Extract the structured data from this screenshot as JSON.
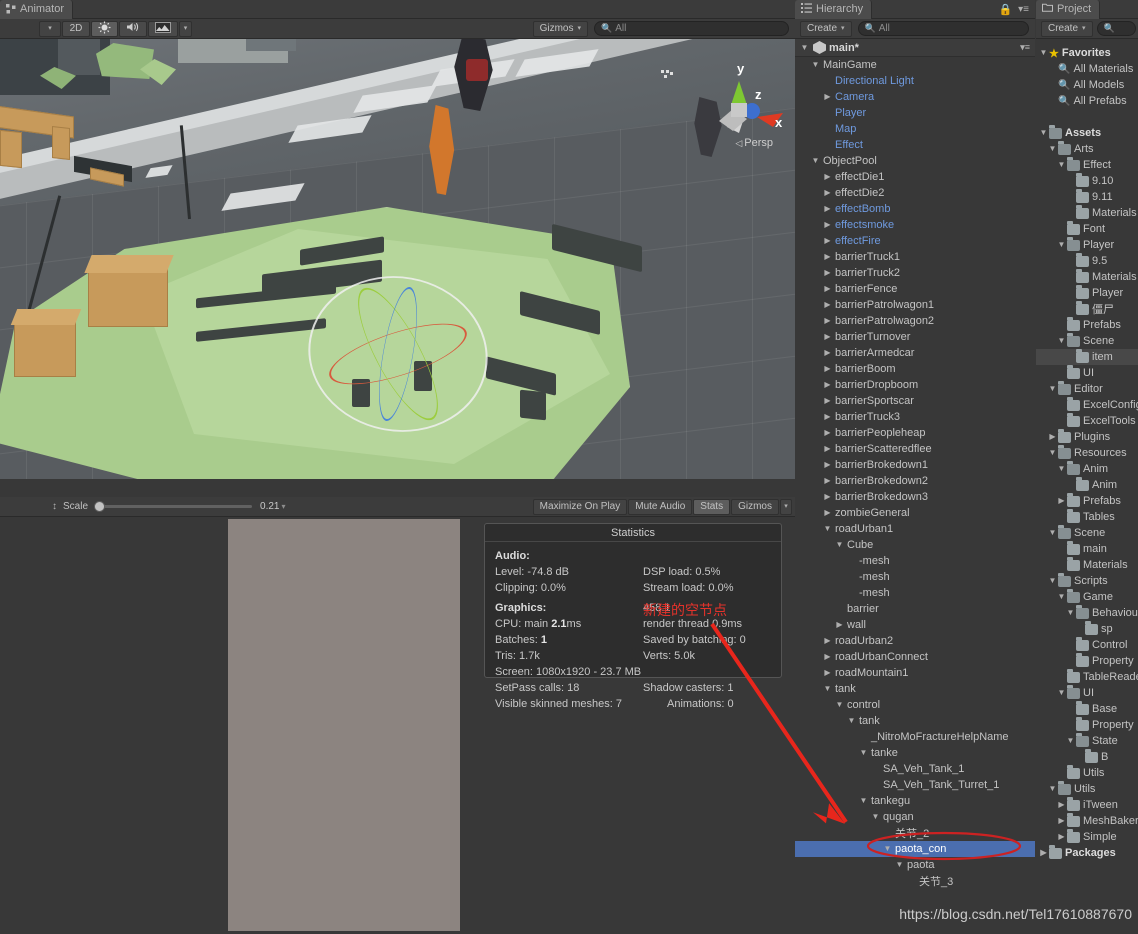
{
  "scene": {
    "tab_label": "Animator",
    "tab_icon": "animator-icon",
    "toolbar": {
      "draw_mode_caret": "▾",
      "mode_2d": "2D",
      "light_icon": "light-toggle-icon",
      "audio_icon": "audio-toggle-icon",
      "fx_icon": "effects-toggle-icon",
      "fx_caret": "▾",
      "gizmos_label": "Gizmos",
      "gizmos_caret": "▾",
      "search_placeholder": "All",
      "search_value": "",
      "search_icon": "search-icon"
    },
    "axis": {
      "x": "x",
      "y": "y",
      "z": "z",
      "projection": "Persp",
      "persp_caret": "◁"
    }
  },
  "game": {
    "toolbar": {
      "resize_handle": "↕",
      "scale_label": "Scale",
      "scale_value": "0.21",
      "maximize_label": "Maximize On Play",
      "mute_label": "Mute Audio",
      "stats_label": "Stats",
      "gizmos_label": "Gizmos",
      "gizmos_caret": "▾"
    }
  },
  "statistics": {
    "title": "Statistics",
    "audio_header": "Audio:",
    "audio_rows": [
      {
        "left": "Level: -74.8 dB",
        "right": "DSP load: 0.5%"
      },
      {
        "left": "Clipping: 0.0%",
        "right": "Stream load: 0.0%"
      }
    ],
    "graphics_header": "Graphics:",
    "graphics_fps": "458.1",
    "graphics_rows": [
      {
        "left": "CPU: main",
        "bold": "2.1",
        "left_tail": "ms",
        "right": "render thread 0.9ms"
      },
      {
        "left": "Batches:",
        "bold": "1",
        "left_tail": "",
        "right": "Saved by batching: 0"
      },
      {
        "left": "Tris: 1.7k",
        "bold": "",
        "left_tail": "",
        "right": "Verts: 5.0k"
      },
      {
        "left": "Screen: 1080x1920 - 23.7 MB",
        "bold": "",
        "left_tail": "",
        "right": ""
      },
      {
        "left": "SetPass calls: 18",
        "bold": "",
        "left_tail": "",
        "right": "Shadow casters: 1"
      },
      {
        "left": "Visible skinned meshes: 7",
        "bold": "",
        "left_tail": "",
        "right": "Animations: 0"
      }
    ]
  },
  "hierarchy": {
    "tab_label": "Hierarchy",
    "tab_icon": "hierarchy-icon",
    "lock_icon": "lock-icon",
    "menu_icon": "panel-menu-icon",
    "create_label": "Create",
    "create_caret": "▾",
    "search_placeholder": "All",
    "search_icon": "search-icon",
    "scene_name": "main*",
    "items": [
      {
        "label": "MainGame",
        "depth": 1,
        "arrow": "down",
        "prefab": false
      },
      {
        "label": "Directional Light",
        "depth": 2,
        "arrow": "none",
        "prefab": true
      },
      {
        "label": "Camera",
        "depth": 2,
        "arrow": "right",
        "prefab": true
      },
      {
        "label": "Player",
        "depth": 2,
        "arrow": "none",
        "prefab": true
      },
      {
        "label": "Map",
        "depth": 2,
        "arrow": "none",
        "prefab": true
      },
      {
        "label": "Effect",
        "depth": 2,
        "arrow": "none",
        "prefab": true
      },
      {
        "label": "ObjectPool",
        "depth": 1,
        "arrow": "down",
        "prefab": false
      },
      {
        "label": "effectDie1",
        "depth": 2,
        "arrow": "right",
        "prefab": false
      },
      {
        "label": "effectDie2",
        "depth": 2,
        "arrow": "right",
        "prefab": false
      },
      {
        "label": "effectBomb",
        "depth": 2,
        "arrow": "right",
        "prefab": true
      },
      {
        "label": "effectsmoke",
        "depth": 2,
        "arrow": "right",
        "prefab": true
      },
      {
        "label": "effectFire",
        "depth": 2,
        "arrow": "right",
        "prefab": true
      },
      {
        "label": "barrierTruck1",
        "depth": 2,
        "arrow": "right",
        "prefab": false
      },
      {
        "label": "barrierTruck2",
        "depth": 2,
        "arrow": "right",
        "prefab": false
      },
      {
        "label": "barrierFence",
        "depth": 2,
        "arrow": "right",
        "prefab": false
      },
      {
        "label": "barrierPatrolwagon1",
        "depth": 2,
        "arrow": "right",
        "prefab": false
      },
      {
        "label": "barrierPatrolwagon2",
        "depth": 2,
        "arrow": "right",
        "prefab": false
      },
      {
        "label": "barrierTurnover",
        "depth": 2,
        "arrow": "right",
        "prefab": false
      },
      {
        "label": "barrierArmedcar",
        "depth": 2,
        "arrow": "right",
        "prefab": false
      },
      {
        "label": "barrierBoom",
        "depth": 2,
        "arrow": "right",
        "prefab": false
      },
      {
        "label": "barrierDropboom",
        "depth": 2,
        "arrow": "right",
        "prefab": false
      },
      {
        "label": "barrierSportscar",
        "depth": 2,
        "arrow": "right",
        "prefab": false
      },
      {
        "label": "barrierTruck3",
        "depth": 2,
        "arrow": "right",
        "prefab": false
      },
      {
        "label": "barrierPeopleheap",
        "depth": 2,
        "arrow": "right",
        "prefab": false
      },
      {
        "label": "barrierScatteredflee",
        "depth": 2,
        "arrow": "right",
        "prefab": false
      },
      {
        "label": "barrierBrokedown1",
        "depth": 2,
        "arrow": "right",
        "prefab": false
      },
      {
        "label": "barrierBrokedown2",
        "depth": 2,
        "arrow": "right",
        "prefab": false
      },
      {
        "label": "barrierBrokedown3",
        "depth": 2,
        "arrow": "right",
        "prefab": false
      },
      {
        "label": "zombieGeneral",
        "depth": 2,
        "arrow": "right",
        "prefab": false
      },
      {
        "label": "roadUrban1",
        "depth": 2,
        "arrow": "down",
        "prefab": false
      },
      {
        "label": "Cube",
        "depth": 3,
        "arrow": "down",
        "prefab": false
      },
      {
        "label": "-mesh",
        "depth": 4,
        "arrow": "none",
        "prefab": false
      },
      {
        "label": "-mesh",
        "depth": 4,
        "arrow": "none",
        "prefab": false
      },
      {
        "label": "-mesh",
        "depth": 4,
        "arrow": "none",
        "prefab": false
      },
      {
        "label": "barrier",
        "depth": 3,
        "arrow": "none",
        "prefab": false
      },
      {
        "label": "wall",
        "depth": 3,
        "arrow": "right",
        "prefab": false
      },
      {
        "label": "roadUrban2",
        "depth": 2,
        "arrow": "right",
        "prefab": false
      },
      {
        "label": "roadUrbanConnect",
        "depth": 2,
        "arrow": "right",
        "prefab": false
      },
      {
        "label": "roadMountain1",
        "depth": 2,
        "arrow": "right",
        "prefab": false
      },
      {
        "label": "tank",
        "depth": 2,
        "arrow": "down",
        "prefab": false
      },
      {
        "label": "control",
        "depth": 3,
        "arrow": "down",
        "prefab": false
      },
      {
        "label": "tank",
        "depth": 4,
        "arrow": "down",
        "prefab": false
      },
      {
        "label": "_NitroMoFractureHelpName",
        "depth": 5,
        "arrow": "none",
        "prefab": false
      },
      {
        "label": "tanke",
        "depth": 5,
        "arrow": "down",
        "prefab": false
      },
      {
        "label": "SA_Veh_Tank_1",
        "depth": 6,
        "arrow": "none",
        "prefab": false
      },
      {
        "label": "SA_Veh_Tank_Turret_1",
        "depth": 6,
        "arrow": "none",
        "prefab": false
      },
      {
        "label": "tankegu",
        "depth": 5,
        "arrow": "down",
        "prefab": false
      },
      {
        "label": "qugan",
        "depth": 6,
        "arrow": "down",
        "prefab": false
      },
      {
        "label": "关节_2",
        "depth": 7,
        "arrow": "none",
        "prefab": false
      },
      {
        "label": "paota_con",
        "depth": 7,
        "arrow": "down",
        "prefab": false,
        "selected": true
      },
      {
        "label": "paota",
        "depth": 8,
        "arrow": "down",
        "prefab": false
      },
      {
        "label": "关节_3",
        "depth": 9,
        "arrow": "none",
        "prefab": false
      }
    ]
  },
  "project": {
    "tab_label": "Project",
    "tab_icon": "project-icon",
    "create_label": "Create",
    "create_caret": "▾",
    "search_icon": "search-icon",
    "items": [
      {
        "label": "Favorites",
        "depth": 0,
        "arrow": "down",
        "icon": "star",
        "bold": true
      },
      {
        "label": "All Materials",
        "depth": 1,
        "arrow": "none",
        "icon": "search",
        "bold": false
      },
      {
        "label": "All Models",
        "depth": 1,
        "arrow": "none",
        "icon": "search",
        "bold": false
      },
      {
        "label": "All Prefabs",
        "depth": 1,
        "arrow": "none",
        "icon": "search",
        "bold": false
      },
      {
        "label": "",
        "depth": 0,
        "arrow": "none",
        "icon": "none",
        "bold": false
      },
      {
        "label": "Assets",
        "depth": 0,
        "arrow": "down",
        "icon": "folder",
        "bold": true
      },
      {
        "label": "Arts",
        "depth": 1,
        "arrow": "down",
        "icon": "folder",
        "bold": false
      },
      {
        "label": "Effect",
        "depth": 2,
        "arrow": "down",
        "icon": "folder",
        "bold": false
      },
      {
        "label": "9.10",
        "depth": 3,
        "arrow": "none",
        "icon": "folder",
        "bold": false
      },
      {
        "label": "9.11",
        "depth": 3,
        "arrow": "none",
        "icon": "folder",
        "bold": false
      },
      {
        "label": "Materials",
        "depth": 3,
        "arrow": "none",
        "icon": "folder",
        "bold": false
      },
      {
        "label": "Font",
        "depth": 2,
        "arrow": "none",
        "icon": "folder",
        "bold": false
      },
      {
        "label": "Player",
        "depth": 2,
        "arrow": "down",
        "icon": "folder",
        "bold": false
      },
      {
        "label": "9.5",
        "depth": 3,
        "arrow": "none",
        "icon": "folder",
        "bold": false
      },
      {
        "label": "Materials",
        "depth": 3,
        "arrow": "none",
        "icon": "folder",
        "bold": false
      },
      {
        "label": "Player",
        "depth": 3,
        "arrow": "none",
        "icon": "folder",
        "bold": false
      },
      {
        "label": "僵尸",
        "depth": 3,
        "arrow": "none",
        "icon": "folder",
        "bold": false
      },
      {
        "label": "Prefabs",
        "depth": 2,
        "arrow": "none",
        "icon": "folder",
        "bold": false
      },
      {
        "label": "Scene",
        "depth": 2,
        "arrow": "down",
        "icon": "folder",
        "bold": false
      },
      {
        "label": "item",
        "depth": 3,
        "arrow": "none",
        "icon": "folder",
        "bold": false,
        "highlight": true
      },
      {
        "label": "UI",
        "depth": 2,
        "arrow": "none",
        "icon": "folder",
        "bold": false
      },
      {
        "label": "Editor",
        "depth": 1,
        "arrow": "down",
        "icon": "folder",
        "bold": false
      },
      {
        "label": "ExcelConfig",
        "depth": 2,
        "arrow": "none",
        "icon": "folder",
        "bold": false
      },
      {
        "label": "ExcelTools",
        "depth": 2,
        "arrow": "none",
        "icon": "folder",
        "bold": false
      },
      {
        "label": "Plugins",
        "depth": 1,
        "arrow": "right",
        "icon": "folder",
        "bold": false
      },
      {
        "label": "Resources",
        "depth": 1,
        "arrow": "down",
        "icon": "folder",
        "bold": false
      },
      {
        "label": "Anim",
        "depth": 2,
        "arrow": "down",
        "icon": "folder",
        "bold": false
      },
      {
        "label": "Anim",
        "depth": 3,
        "arrow": "none",
        "icon": "folder",
        "bold": false
      },
      {
        "label": "Prefabs",
        "depth": 2,
        "arrow": "right",
        "icon": "folder",
        "bold": false
      },
      {
        "label": "Tables",
        "depth": 2,
        "arrow": "none",
        "icon": "folder",
        "bold": false
      },
      {
        "label": "Scene",
        "depth": 1,
        "arrow": "down",
        "icon": "folder",
        "bold": false
      },
      {
        "label": "main",
        "depth": 2,
        "arrow": "none",
        "icon": "folder",
        "bold": false
      },
      {
        "label": "Materials",
        "depth": 2,
        "arrow": "none",
        "icon": "folder",
        "bold": false
      },
      {
        "label": "Scripts",
        "depth": 1,
        "arrow": "down",
        "icon": "folder",
        "bold": false
      },
      {
        "label": "Game",
        "depth": 2,
        "arrow": "down",
        "icon": "folder",
        "bold": false
      },
      {
        "label": "Behaviour",
        "depth": 3,
        "arrow": "down",
        "icon": "folder",
        "bold": false
      },
      {
        "label": "sp",
        "depth": 4,
        "arrow": "none",
        "icon": "folder",
        "bold": false
      },
      {
        "label": "Control",
        "depth": 3,
        "arrow": "none",
        "icon": "folder",
        "bold": false
      },
      {
        "label": "Property",
        "depth": 3,
        "arrow": "none",
        "icon": "folder",
        "bold": false
      },
      {
        "label": "TableReader",
        "depth": 2,
        "arrow": "none",
        "icon": "folder",
        "bold": false
      },
      {
        "label": "UI",
        "depth": 2,
        "arrow": "down",
        "icon": "folder",
        "bold": false
      },
      {
        "label": "Base",
        "depth": 3,
        "arrow": "none",
        "icon": "folder",
        "bold": false
      },
      {
        "label": "Property",
        "depth": 3,
        "arrow": "none",
        "icon": "folder",
        "bold": false
      },
      {
        "label": "State",
        "depth": 3,
        "arrow": "down",
        "icon": "folder",
        "bold": false
      },
      {
        "label": "B",
        "depth": 4,
        "arrow": "none",
        "icon": "folder",
        "bold": false
      },
      {
        "label": "Utils",
        "depth": 2,
        "arrow": "none",
        "icon": "folder",
        "bold": false
      },
      {
        "label": "Utils",
        "depth": 1,
        "arrow": "down",
        "icon": "folder",
        "bold": false
      },
      {
        "label": "iTween",
        "depth": 2,
        "arrow": "right",
        "icon": "folder",
        "bold": false
      },
      {
        "label": "MeshBaker",
        "depth": 2,
        "arrow": "right",
        "icon": "folder",
        "bold": false
      },
      {
        "label": "Simple",
        "depth": 2,
        "arrow": "right",
        "icon": "folder",
        "bold": false
      },
      {
        "label": "Packages",
        "depth": 0,
        "arrow": "right",
        "icon": "folder",
        "bold": true
      }
    ]
  },
  "annotations": {
    "note_text": "新建的空节点",
    "note_color": "#e4322b",
    "arrow_color": "#e8261c",
    "ellipse_color": "#cc2222",
    "watermark": "https://blog.csdn.net/Tel17610887670"
  }
}
